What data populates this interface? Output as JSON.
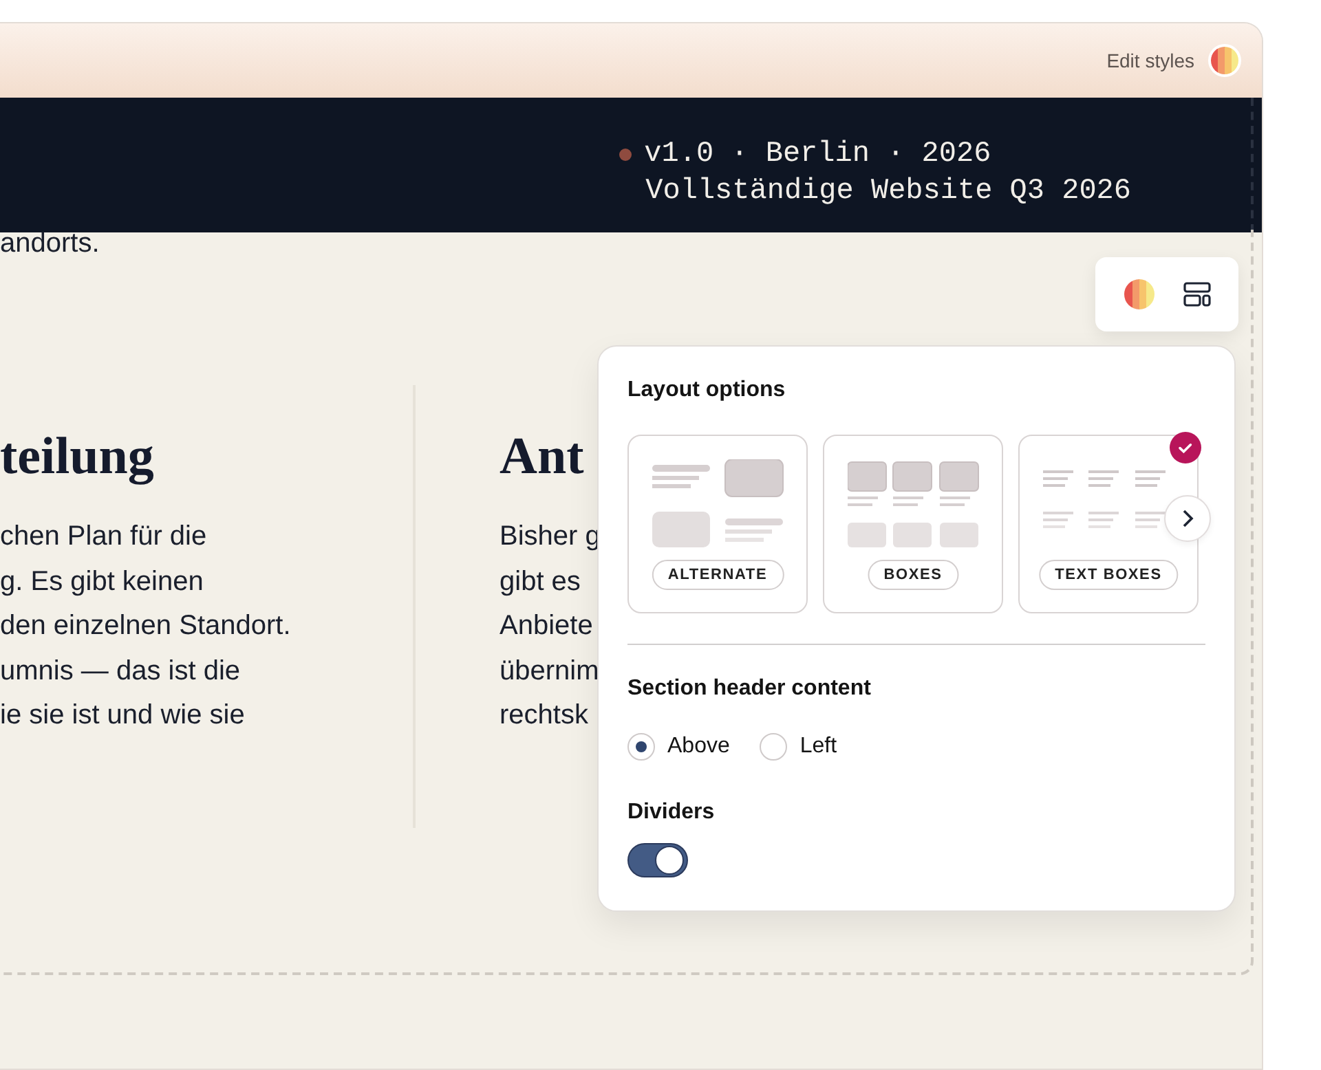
{
  "topbar": {
    "edit_styles": "Edit styles"
  },
  "hero": {
    "meta_line": "v1.0 · Berlin · 2026",
    "subtitle": "Vollständige Website Q3 2026"
  },
  "intro_fragment": "andorts.",
  "columns": [
    {
      "heading": "teilung",
      "lines": [
        "chen Plan für die",
        "g. Es gibt keinen",
        " den einzelnen Standort.",
        "umnis — das ist die",
        "ie sie ist und wie sie"
      ]
    },
    {
      "heading": "Ant",
      "lines": [
        "Bisher g",
        "gibt es",
        "Anbiete",
        "übernim",
        "rechtsk"
      ]
    }
  ],
  "panel": {
    "title": "Layout options",
    "layouts": [
      {
        "kind": "alternate",
        "label": "ALTERNATE",
        "selected": false
      },
      {
        "kind": "boxes",
        "label": "BOXES",
        "selected": false
      },
      {
        "kind": "text_boxes",
        "label": "TEXT BOXES",
        "selected": true
      }
    ],
    "header_title": "Section header content",
    "header_options": [
      {
        "label": "Above",
        "selected": true
      },
      {
        "label": "Left",
        "selected": false
      }
    ],
    "dividers_title": "Dividers",
    "dividers_on": true
  }
}
